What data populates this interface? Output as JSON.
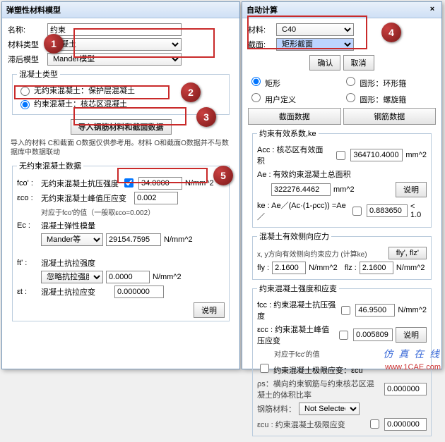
{
  "left": {
    "title": "弹塑性材料模型",
    "name_lbl": "名称:",
    "name_val": "约束",
    "type_lbl": "材料类型",
    "type_val": "混凝土",
    "model_lbl": "滞后模型",
    "model_val": "Mander模型",
    "group_concrete": "混凝土类型",
    "opt_unconf": "无约束混凝土：保护层混凝土",
    "opt_conf": "约束混凝土：核芯区混凝土",
    "btn_import": "导入钢筋材料和截面数据",
    "note": "导入的材料 C和截面 O数据仅供参考用。材料 O和截面O数据并不与数据库中数据联动",
    "group_unconf_data": "无约束混凝土数据",
    "fco_lbl": "fco' :",
    "fco_desc": "无约束混凝土抗压强度",
    "fco_val": "34.0000",
    "fco_unit": "N/mm^2",
    "eco_lbl": "εco :",
    "eco_desc": "无约束混凝土峰值压应变",
    "eco_val": "0.002",
    "eco_note": "对应于fco'的值（一般取εco=0.002）",
    "ec_lbl": "Ec :",
    "ec_desc": "混凝土弹性模量",
    "ec_sel": "Mander等",
    "ec_val": "29154.7595",
    "ec_unit": "N/mm^2",
    "ft_lbl": "ft' :",
    "ft_desc": "混凝土抗拉强度",
    "ft_sel": "忽略抗拉强度",
    "ft_val": "0.0000",
    "ft_unit": "N/mm^2",
    "et_lbl": "εt :",
    "et_desc": "混凝土抗拉应变",
    "et_val": "0.000000",
    "btn_explain": "说明"
  },
  "right": {
    "title": "自动计算",
    "mat_lbl": "材料:",
    "mat_val": "C40",
    "sec_lbl": "截面:",
    "sec_val": "矩形截面",
    "ok": "确认",
    "cancel": "取消",
    "shape_rect": "矩形",
    "shape_circ_ring": "圆形：环形箍",
    "shape_user": "用户定义",
    "shape_circ_spiral": "圆形：螺旋箍",
    "tab_section": "截面数据",
    "tab_rebar": "钢筋数据",
    "group_eff": "约束有效系数,ke",
    "acc_lbl": "Acc : 核芯区有效面积",
    "acc_val": "364710.4000",
    "unit_mm2": "mm^2",
    "ae_lbl": "Ae : 有效约束混凝土总面积",
    "ae_val": "322276.4462",
    "btn_explain2": "说明",
    "ke_formula": "ke : Ae／(Ac·(1-ρcc)) =Ae／",
    "ke_val": "0.883650",
    "ke_tail": "< 1.0",
    "group_lateral": "混凝土有效侧向应力",
    "lat_desc": "x, y方向有效侧向约束应力 (计算ke)",
    "btn_flyflz": "fly', flz'",
    "fly_lbl": "fly :",
    "fly_val": "2.1600",
    "flz_lbl": "flz :",
    "flz_val": "2.1600",
    "fl_unit": "N/mm^2",
    "group_strength": "约束混凝土强度和应变",
    "fcc_lbl": "fcc : 约束混凝土抗压强度",
    "fcc_val": "46.9500",
    "fcc_unit": "N/mm^2",
    "ecc_lbl": "εcc : 约束混凝土峰值压应变",
    "ecc_val": "0.005809",
    "ecc_note": "对应于fcc'的值",
    "ecu_head": "约束混凝土极限应变：εcu",
    "ps_lbl": "ρs：横向约束钢筋与约束核芯区混凝土的体积比率",
    "ps_val": "0.000000",
    "rebar_lbl": "钢筋材料：",
    "rebar_val": "Not Selected",
    "ecu_lbl": "εcu : 约束混凝土极限应变",
    "ecu_val": "0.000000"
  },
  "watermark": "仿 真 在 线",
  "url": "www.1CAE.com"
}
